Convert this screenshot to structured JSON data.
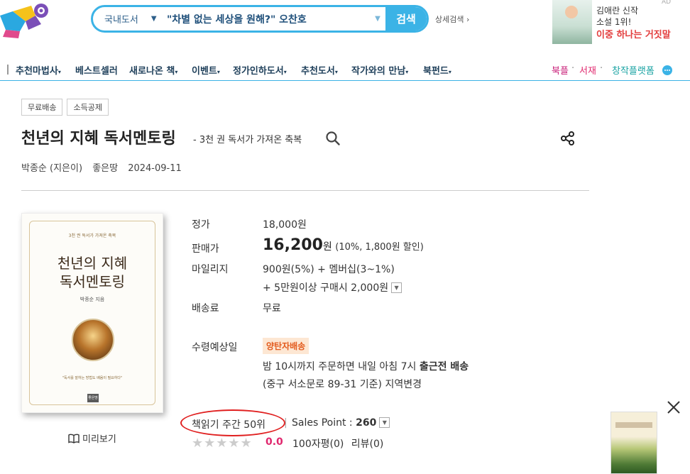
{
  "header": {
    "search": {
      "category": "국내도서",
      "query": "\"차별 없는 세상을 원해?\" 오찬호",
      "button": "검색",
      "advanced": "상세검색 ›"
    },
    "ad": {
      "tag": "AD",
      "line1": "김애란 신작",
      "line2": "소설 1위!",
      "line3": "이중 하나는 거짓말"
    }
  },
  "gnb": {
    "items": [
      {
        "label": "추천마법사",
        "arrow": "▾"
      },
      {
        "label": "베스트셀러",
        "arrow": ""
      },
      {
        "label": "새로나온 책",
        "arrow": "▾"
      },
      {
        "label": "이벤트",
        "arrow": "▾"
      },
      {
        "label": "정가인하도서",
        "arrow": "▾"
      },
      {
        "label": "추천도서",
        "arrow": "▾"
      },
      {
        "label": "작가와의 만남",
        "arrow": "▾"
      },
      {
        "label": "북펀드",
        "arrow": "▾"
      }
    ],
    "right": {
      "bookple": "북플",
      "dot1": "·",
      "seojae": "서재",
      "dot2": "·",
      "platform": "창작플랫폼",
      "colors": {
        "bookple": "#c9207a",
        "seojae": "#e0286e",
        "platform": "#1aa3a3"
      }
    }
  },
  "product": {
    "tags": [
      "무료배송",
      "소득공제"
    ],
    "title": "천년의 지혜 독서멘토링",
    "subtitle": "- 3천 권 독서가 가져온 축복",
    "author": "박종순 (지은이)",
    "publisher": "좋은땅",
    "date": "2024-09-11",
    "cover": {
      "subtitle": "3천 권 독서가 가져온 축복",
      "title_line1": "천년의 지혜",
      "title_line2": "독서멘토링",
      "author": "박종순 지음",
      "quote": "\"독서를 잘하는 방법도 배움이 필요하다\"",
      "publisher": "좋은땅"
    },
    "preview": "미리보기",
    "price": {
      "list_label": "정가",
      "list_value": "18,000원",
      "sale_label": "판매가",
      "sale_number": "16,200",
      "sale_unit": "원",
      "sale_discount": "(10%, 1,800원 할인)",
      "mileage_label": "마일리지",
      "mileage_value": "900원(5%) + 멤버십(3~1%)",
      "mileage_extra": "+ 5만원이상 구매시 2,000원",
      "shipping_label": "배송료",
      "shipping_value": "무료"
    },
    "delivery": {
      "label": "수령예상일",
      "badge": "양탄자배송",
      "line1_pre": "밤 10시까지 주문하면 내일 아침 7시 ",
      "line1_bold": "출근전 배송",
      "line2": "(중구 서소문로 89-31 기준) 지역변경"
    },
    "rank": {
      "text": "책읽기 주간 50위",
      "sales_point_label": "Sales Point : ",
      "sales_point_value": "260",
      "stars": "★★★★★",
      "score": "0.0",
      "review100": "100자평(0)",
      "review": "리뷰(0)"
    }
  }
}
